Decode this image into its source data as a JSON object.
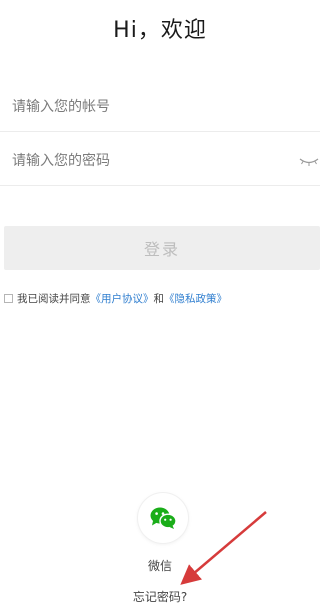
{
  "header": {
    "title": "Hi，欢迎"
  },
  "form": {
    "account_placeholder": "请输入您的帐号",
    "password_placeholder": "请输入您的密码",
    "login_label": "登录"
  },
  "agreement": {
    "prefix": "我已阅读并同意",
    "user_agreement": "《用户协议》",
    "and": "和",
    "privacy_policy": "《隐私政策》",
    "checked": false
  },
  "third_party": {
    "wechat_label": "微信",
    "icon": "wechat-icon"
  },
  "forgot_password": "忘记密码?",
  "colors": {
    "link": "#2f7ecf",
    "wechat_green": "#1aad19",
    "arrow": "#d63b3b",
    "login_disabled_bg": "#eeeeee"
  }
}
